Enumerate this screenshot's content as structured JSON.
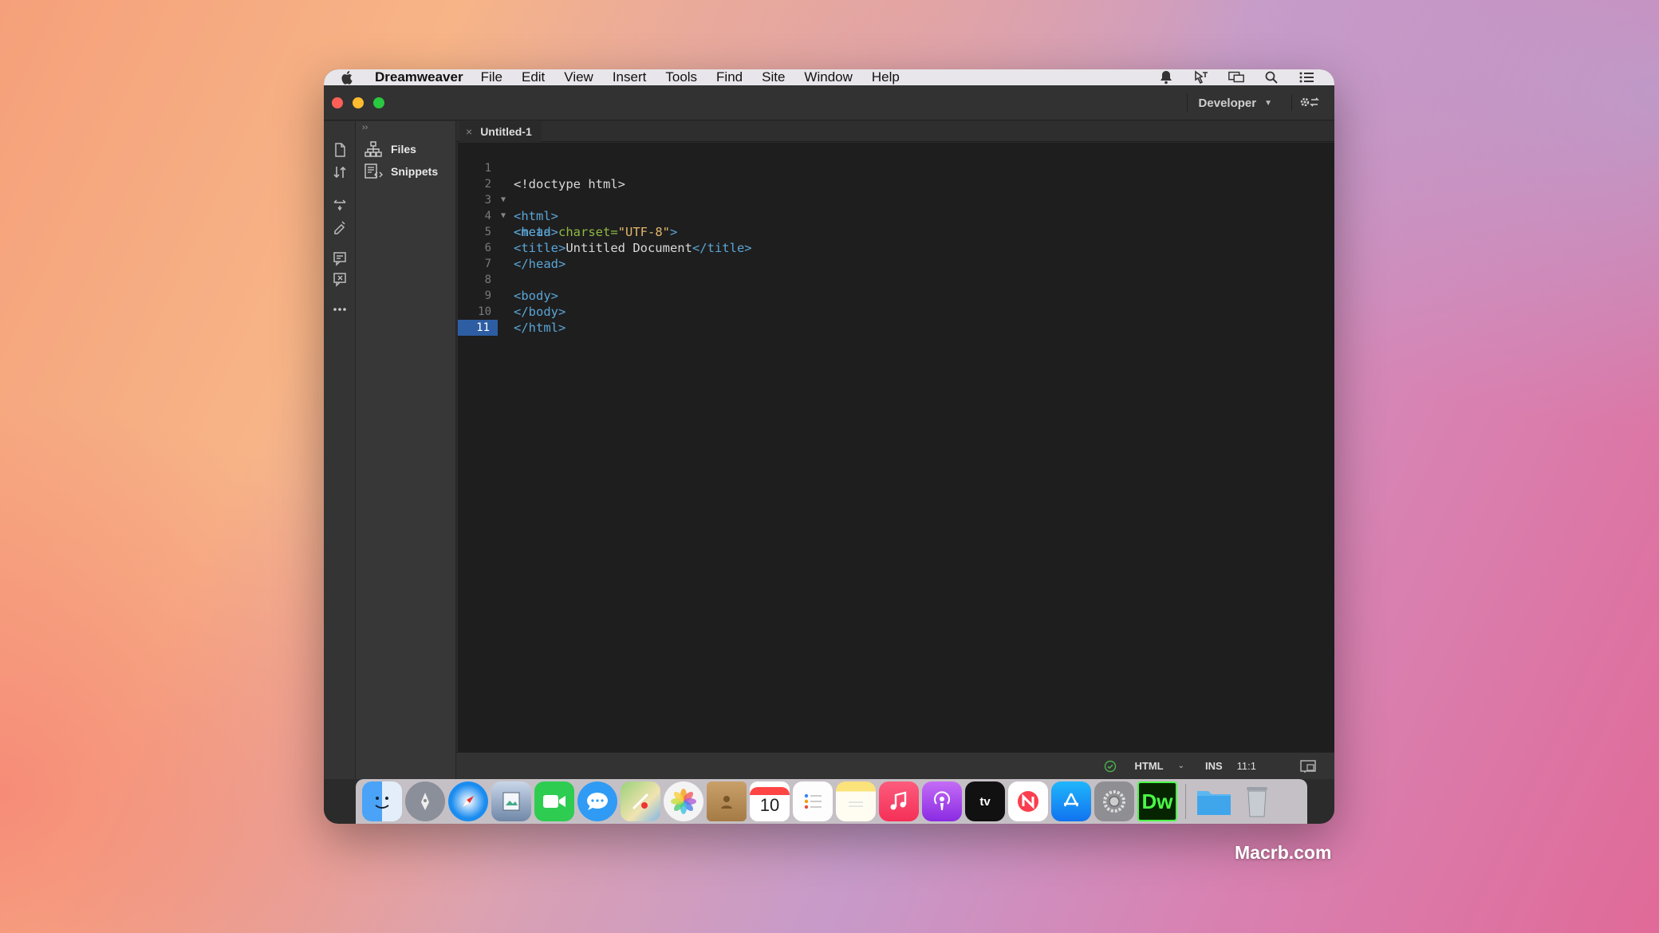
{
  "menubar": {
    "app_name": "Dreamweaver",
    "items": [
      "File",
      "Edit",
      "View",
      "Insert",
      "Tools",
      "Find",
      "Site",
      "Window",
      "Help"
    ]
  },
  "titlebar": {
    "workspace": "Developer"
  },
  "panel": {
    "items": [
      {
        "label": "Files",
        "icon": "site-tree-icon"
      },
      {
        "label": "Snippets",
        "icon": "snippets-icon"
      }
    ]
  },
  "tab": {
    "label": "Untitled-1",
    "close": "×"
  },
  "editor": {
    "line_numbers": [
      "1",
      "2",
      "3",
      "4",
      "5",
      "6",
      "7",
      "8",
      "9",
      "10",
      "11"
    ],
    "active_line": 11,
    "colors": {
      "tag": "#5aa5d6",
      "attr": "#8fb944",
      "string": "#e2b86b",
      "gutter_active": "#2d5ea3"
    }
  },
  "code": {
    "l1": "<!doctype html>",
    "l2": "<html>",
    "l3": "<head>",
    "l4_tag_open": "<meta ",
    "l4_attr": "charset=",
    "l4_val": "\"UTF-8\"",
    "l4_close": ">",
    "l5_open": "<title>",
    "l5_text": "Untitled Document",
    "l5_close": "</title>",
    "l6": "</head>",
    "l8": "<body>",
    "l9": "</body>",
    "l10": "</html>"
  },
  "statusbar": {
    "language": "HTML",
    "mode": "INS",
    "position": "11:1"
  },
  "dock": {
    "icons": [
      "finder-icon",
      "launchpad-icon",
      "safari-icon",
      "preview-icon",
      "facetime-icon",
      "messages-icon",
      "maps-icon",
      "photos-icon",
      "contacts-icon",
      "calendar-icon",
      "reminders-icon",
      "notes-icon",
      "music-icon",
      "podcasts-icon",
      "apple-tv-icon",
      "news-icon",
      "app-store-icon",
      "system-preferences-icon",
      "dreamweaver-icon",
      "folder-icon",
      "trash-icon"
    ],
    "calendar_day": "10",
    "tv_label": "tv",
    "dw_label": "Dw"
  },
  "watermark": "Macrb.com"
}
